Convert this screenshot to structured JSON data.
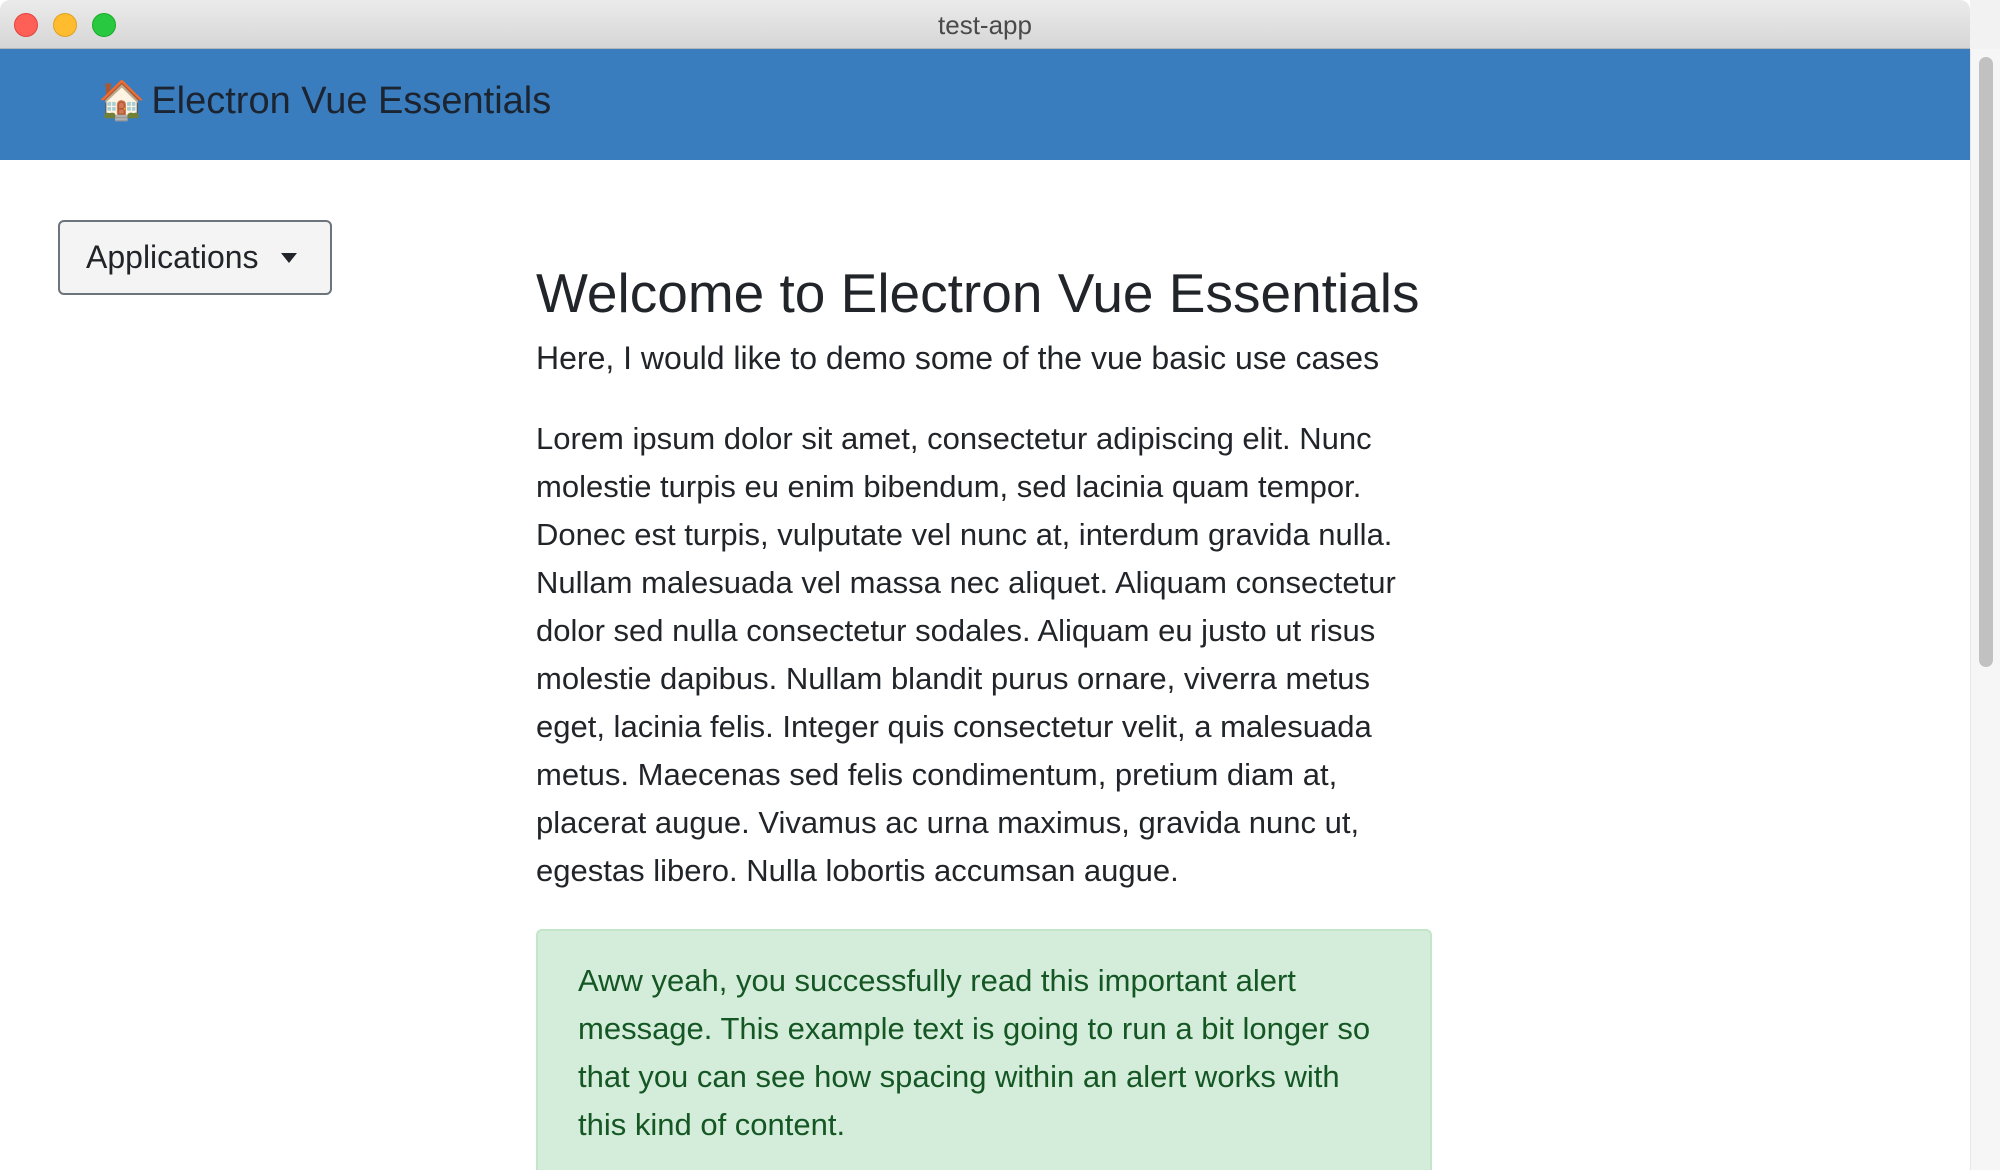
{
  "window": {
    "title": "test-app"
  },
  "navbar": {
    "brand_icon": "🏠",
    "brand_label": "Electron Vue Essentials"
  },
  "sidebar": {
    "dropdown_label": "Applications"
  },
  "main": {
    "title": "Welcome to Electron Vue Essentials",
    "lead": "Here, I would like to demo some of the vue basic use cases",
    "body": "Lorem ipsum dolor sit amet, consectetur adipiscing elit. Nunc molestie turpis eu enim bibendum, sed lacinia quam tempor. Donec est turpis, vulputate vel nunc at, interdum gravida nulla. Nullam malesuada vel massa nec aliquet. Aliquam consectetur dolor sed nulla consectetur sodales. Aliquam eu justo ut risus molestie dapibus. Nullam blandit purus ornare, viverra metus eget, lacinia felis. Integer quis consectetur velit, a malesuada metus. Maecenas sed felis condimentum, pretium diam at, placerat augue. Vivamus ac urna maximus, gravida nunc ut, egestas libero. Nulla lobortis accumsan augue.",
    "alert": "Aww yeah, you successfully read this important alert message. This example text is going to run a bit longer so that you can see how spacing within an alert works with this kind of content."
  },
  "colors": {
    "navbar": "#3a7dbe",
    "alert_background": "#d4edda",
    "alert_text": "#155724"
  }
}
